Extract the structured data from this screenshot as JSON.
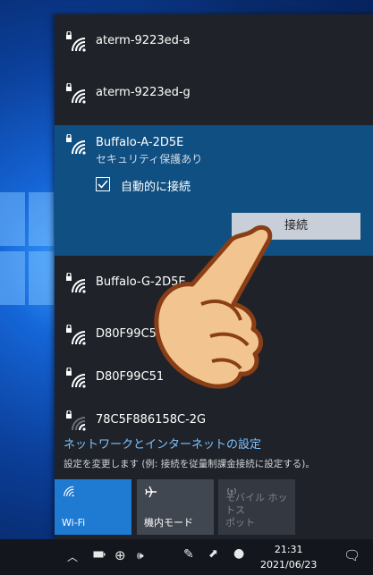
{
  "networks": [
    {
      "ssid": "aterm-9223ed-a",
      "locked": true
    },
    {
      "ssid": "aterm-9223ed-g",
      "locked": true
    },
    {
      "ssid": "Buffalo-A-2D5E",
      "locked": true,
      "security": "セキュリティ保護あり",
      "auto_connect_label": "自動的に接続",
      "auto_connect_checked": true,
      "connect_label": "接続"
    },
    {
      "ssid": "Buffalo-G-2D5E",
      "locked": true
    },
    {
      "ssid": "D80F99C5",
      "locked": true
    },
    {
      "ssid": "D80F99C51",
      "locked": true
    },
    {
      "ssid": "78C5F886158C-2G",
      "locked": true
    }
  ],
  "settings": {
    "title": "ネットワークとインターネットの設定",
    "subtitle": "設定を変更します (例: 接続を従量制課金接続に設定する)。"
  },
  "tiles": {
    "wifi": {
      "label": "Wi-Fi",
      "active": true,
      "icon": "wifi-icon"
    },
    "airplane": {
      "label": "機内モード",
      "active": false,
      "icon": "airplane-icon"
    },
    "hotspot": {
      "label_line1": "モバイル ホットス",
      "label_line2": "ポット",
      "active": false,
      "icon": "hotspot-icon"
    }
  },
  "taskbar": {
    "time": "21:31",
    "date": "2021/06/23"
  },
  "colors": {
    "accent": "#1f7ad2",
    "selected_bg": "#0f4f82",
    "flyout_bg": "#1f2329",
    "link": "#7fc2ff"
  }
}
